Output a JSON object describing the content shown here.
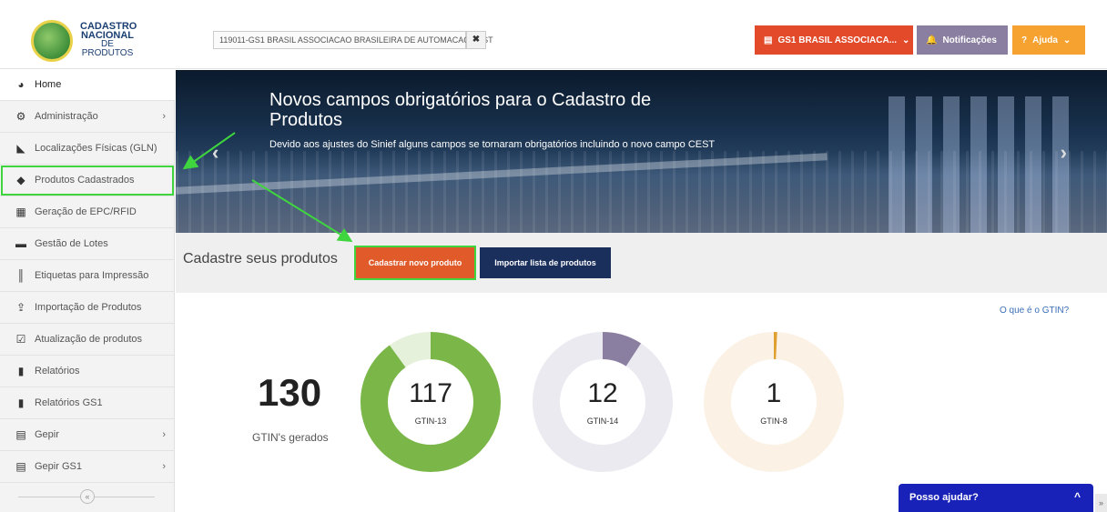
{
  "header": {
    "logo_line1": "CADASTRO",
    "logo_line2": "NACIONAL",
    "logo_line3": "DE PRODUTOS",
    "company_value": "119011-GS1 BRASIL ASSOCIACAO BRASILEIRA DE AUTOMACAO TEST",
    "clear_label": "✖",
    "org_button": "GS1 BRASIL ASSOCIACA...",
    "notif_button": "Notificações",
    "help_button": "Ajuda"
  },
  "sidebar": {
    "items": [
      {
        "label": "Home",
        "icon": "pie-chart-icon"
      },
      {
        "label": "Administração",
        "icon": "cogs-icon"
      },
      {
        "label": "Localizações Físicas (GLN)",
        "icon": "area-chart-icon"
      },
      {
        "label": "Produtos Cadastrados",
        "icon": "tag-icon"
      },
      {
        "label": "Geração de EPC/RFID",
        "icon": "qrcode-icon"
      },
      {
        "label": "Gestão de Lotes",
        "icon": "archive-icon"
      },
      {
        "label": "Etiquetas para Impressão",
        "icon": "barcode-icon"
      },
      {
        "label": "Importação de Produtos",
        "icon": "upload-icon"
      },
      {
        "label": "Atualização de produtos",
        "icon": "check-square-icon"
      },
      {
        "label": "Relatórios",
        "icon": "file-icon"
      },
      {
        "label": "Relatórios GS1",
        "icon": "file-icon"
      },
      {
        "label": "Gepir",
        "icon": "list-icon"
      },
      {
        "label": "Gepir GS1",
        "icon": "list-icon"
      }
    ],
    "collapse_label": "«"
  },
  "banner": {
    "title": "Novos campos obrigatórios para o Cadastro de Produtos",
    "text": "Devido aos ajustes do Sinief alguns campos se tornaram obrigatórios incluindo o novo campo CEST"
  },
  "cta": {
    "title": "Cadastre seus produtos",
    "new_button": "Cadastrar novo produto",
    "import_button": "Importar lista de produtos"
  },
  "stats": {
    "gtin_link": "O que é o GTIN?",
    "total": "130",
    "total_label": "GTIN's gerados",
    "donuts": [
      {
        "value": "117",
        "label": "GTIN-13",
        "color": "#7ab648",
        "track": "#e6f1dc",
        "fraction": 0.9
      },
      {
        "value": "12",
        "label": "GTIN-14",
        "color": "#8a7fa0",
        "track": "#ebeaf0",
        "fraction": 0.092
      },
      {
        "value": "1",
        "label": "GTIN-8",
        "color": "#e0a030",
        "track": "#fbf1e5",
        "fraction": 0.0077
      }
    ]
  },
  "chat": {
    "label": "Posso ajudar?",
    "arrow": "^"
  },
  "scroll_top": "»"
}
